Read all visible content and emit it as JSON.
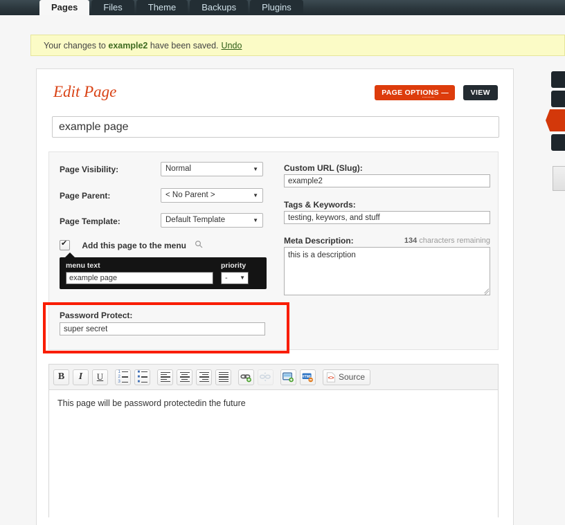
{
  "nav": {
    "tabs": [
      {
        "label": "Pages",
        "active": true
      },
      {
        "label": "Files",
        "active": false
      },
      {
        "label": "Theme",
        "active": false
      },
      {
        "label": "Backups",
        "active": false
      },
      {
        "label": "Plugins",
        "active": false
      }
    ]
  },
  "notice": {
    "prefix": "Your changes to",
    "page_name": "example2",
    "suffix": "have been saved.",
    "undo_label": "Undo"
  },
  "header": {
    "title": "Edit Page",
    "page_options_label": "PAGE OPTI",
    "page_options_label_dotted": "ON",
    "page_options_label_tail": "S —",
    "view_label": "VIEW"
  },
  "title_field": {
    "value": "example page"
  },
  "options": {
    "page_visibility": {
      "label": "Page Visibility:",
      "value": "Normal"
    },
    "page_parent": {
      "label": "Page Parent:",
      "value": "< No Parent >"
    },
    "page_template": {
      "label": "Page Template:",
      "value": "Default Template"
    },
    "add_to_menu": {
      "label": "Add this page to the menu",
      "checked": true
    },
    "menu_popup": {
      "menu_text_label": "menu text",
      "menu_text_value": "example page",
      "priority_label": "priority",
      "priority_value": "-"
    },
    "password_protect": {
      "label": "Password Protect:",
      "value": "super secret"
    },
    "custom_url": {
      "label": "Custom URL (Slug):",
      "value": "example2"
    },
    "tags_keywords": {
      "label": "Tags & Keywords:",
      "value": "testing, keywors, and stuff"
    },
    "meta_description": {
      "label": "Meta Description:",
      "count_number": "134",
      "count_suffix": "characters remaining",
      "value": "this is a description"
    }
  },
  "editor": {
    "toolbar": {
      "bold": "B",
      "italic": "I",
      "underline": "U",
      "source_label": "Source"
    },
    "content": "This page will be password protectedin the future"
  },
  "colors": {
    "accent_orange": "#d3380a",
    "title_orange": "#d94316",
    "highlight_red": "#f91d00",
    "notice_yellow": "#fbfbc6",
    "nav_dark": "#232e34"
  }
}
